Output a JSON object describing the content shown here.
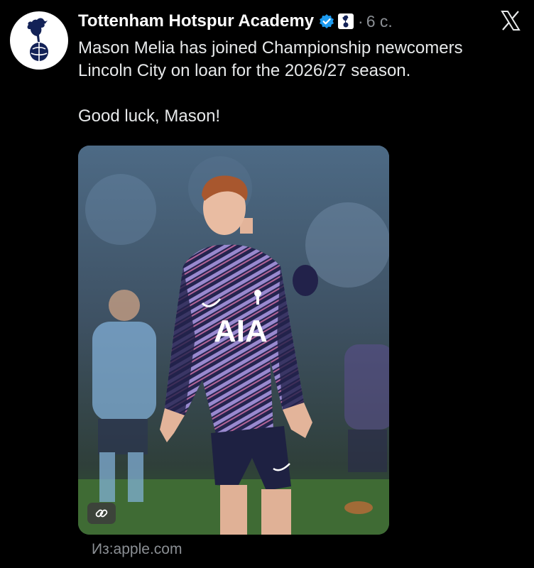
{
  "account": {
    "name": "Tottenham Hotspur Academy",
    "time": "6 с.",
    "separator": "·"
  },
  "post": {
    "line1": "Mason Melia has joined Championship newcomers",
    "line2": "Lincoln City on loan for the 2026/27 season.",
    "line3": "Good luck, Mason!"
  },
  "media": {
    "shirt_sponsor": "AIA",
    "description_icon": "link-icon"
  },
  "link_source": {
    "label": "Из:apple.com"
  },
  "icons": {
    "verified": "verified-badge-icon",
    "affiliate": "tottenham-crest-icon",
    "platform": "x-logo-icon"
  },
  "colors": {
    "verified_blue": "#1d9bf0",
    "club_navy": "#132257",
    "background": "#000000",
    "muted_text": "#8b8f94"
  }
}
